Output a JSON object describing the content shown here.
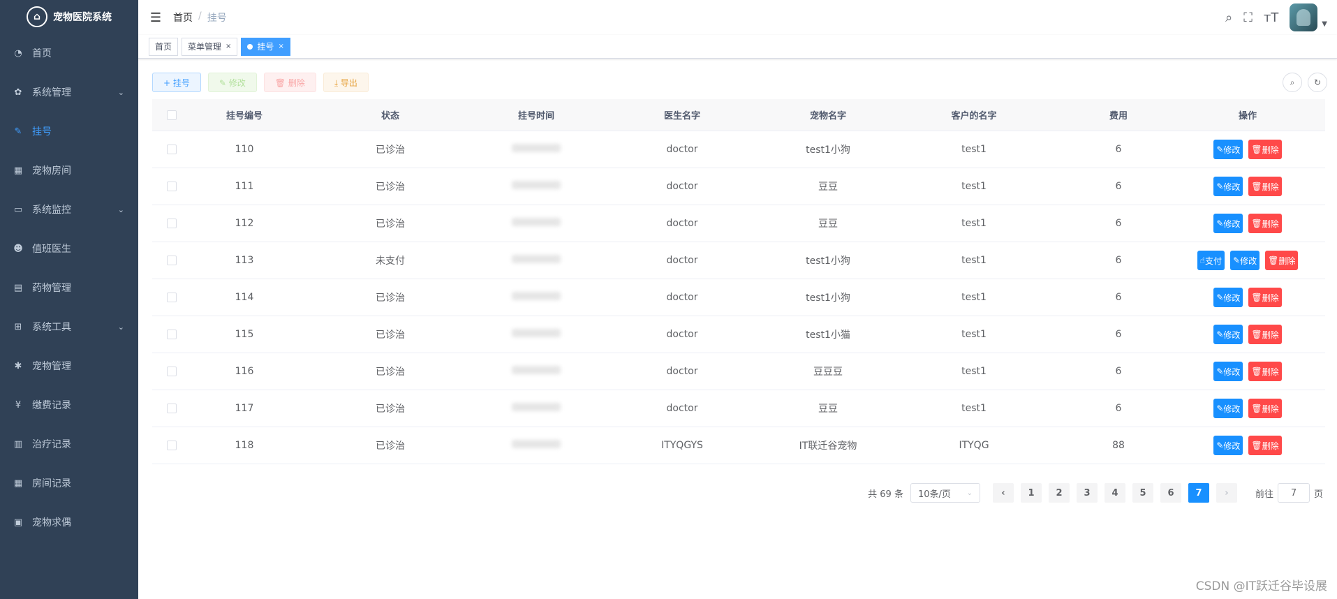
{
  "app": {
    "title": "宠物医院系统"
  },
  "sidebar": {
    "items": [
      {
        "label": "首页",
        "icon": "dashboard-icon",
        "glyph": "◔",
        "caret": false,
        "active": false
      },
      {
        "label": "系统管理",
        "icon": "gear-icon",
        "glyph": "✿",
        "caret": true,
        "active": false
      },
      {
        "label": "挂号",
        "icon": "edit-icon",
        "glyph": "✎",
        "caret": false,
        "active": true
      },
      {
        "label": "宠物房间",
        "icon": "table-icon",
        "glyph": "▦",
        "caret": false,
        "active": false
      },
      {
        "label": "系统监控",
        "icon": "monitor-icon",
        "glyph": "▭",
        "caret": true,
        "active": false
      },
      {
        "label": "值班医生",
        "icon": "peoples-icon",
        "glyph": "☻",
        "caret": false,
        "active": false
      },
      {
        "label": "药物管理",
        "icon": "grid-icon",
        "glyph": "▤",
        "caret": false,
        "active": false
      },
      {
        "label": "系统工具",
        "icon": "tool-icon",
        "glyph": "⊞",
        "caret": true,
        "active": false
      },
      {
        "label": "宠物管理",
        "icon": "bug-icon",
        "glyph": "✱",
        "caret": false,
        "active": false
      },
      {
        "label": "缴费记录",
        "icon": "money-icon",
        "glyph": "¥",
        "caret": false,
        "active": false
      },
      {
        "label": "治疗记录",
        "icon": "document-icon",
        "glyph": "▥",
        "caret": false,
        "active": false
      },
      {
        "label": "房间记录",
        "icon": "table-icon",
        "glyph": "▦",
        "caret": false,
        "active": false
      },
      {
        "label": "宠物求偶",
        "icon": "message-icon",
        "glyph": "▣",
        "caret": false,
        "active": false
      }
    ]
  },
  "header": {
    "breadcrumb_home": "首页",
    "breadcrumb_sep": "/",
    "breadcrumb_current": "挂号"
  },
  "tags": [
    {
      "label": "首页",
      "active": false,
      "closable": false
    },
    {
      "label": "菜单管理",
      "active": false,
      "closable": true
    },
    {
      "label": "挂号",
      "active": true,
      "closable": true
    }
  ],
  "toolbar": {
    "add_label": "+ 挂号",
    "edit_label": "✎ 修改",
    "delete_label": "🗑 删除",
    "export_label": "⤓ 导出"
  },
  "table": {
    "headers": [
      "挂号编号",
      "状态",
      "挂号时间",
      "医生名字",
      "宠物名字",
      "客户的名字",
      "费用",
      "操作"
    ],
    "rows": [
      {
        "id": "110",
        "status": "已诊治",
        "doctor": "doctor",
        "pet": "test1小狗",
        "customer": "test1",
        "fee": "6",
        "pay": false
      },
      {
        "id": "111",
        "status": "已诊治",
        "doctor": "doctor",
        "pet": "豆豆",
        "customer": "test1",
        "fee": "6",
        "pay": false
      },
      {
        "id": "112",
        "status": "已诊治",
        "doctor": "doctor",
        "pet": "豆豆",
        "customer": "test1",
        "fee": "6",
        "pay": false
      },
      {
        "id": "113",
        "status": "未支付",
        "doctor": "doctor",
        "pet": "test1小狗",
        "customer": "test1",
        "fee": "6",
        "pay": true
      },
      {
        "id": "114",
        "status": "已诊治",
        "doctor": "doctor",
        "pet": "test1小狗",
        "customer": "test1",
        "fee": "6",
        "pay": false
      },
      {
        "id": "115",
        "status": "已诊治",
        "doctor": "doctor",
        "pet": "test1小猫",
        "customer": "test1",
        "fee": "6",
        "pay": false
      },
      {
        "id": "116",
        "status": "已诊治",
        "doctor": "doctor",
        "pet": "豆豆豆",
        "customer": "test1",
        "fee": "6",
        "pay": false
      },
      {
        "id": "117",
        "status": "已诊治",
        "doctor": "doctor",
        "pet": "豆豆",
        "customer": "test1",
        "fee": "6",
        "pay": false
      },
      {
        "id": "118",
        "status": "已诊治",
        "doctor": "ITYQGYS",
        "pet": "IT联迁谷宠物",
        "customer": "ITYQG",
        "fee": "88",
        "pay": false
      }
    ],
    "op_edit": "修改",
    "op_delete": "删除",
    "op_pay": "支付"
  },
  "pagination": {
    "total_text": "共 69 条",
    "page_size": "10条/页",
    "pages": [
      "1",
      "2",
      "3",
      "4",
      "5",
      "6",
      "7"
    ],
    "current": "7",
    "goto_label": "前往",
    "goto_value": "7",
    "page_unit": "页"
  },
  "watermark": "CSDN @IT跃迁谷毕设展",
  "colors": {
    "sidebar_bg": "#304156",
    "primary": "#1890ff",
    "danger": "#ff4949"
  }
}
